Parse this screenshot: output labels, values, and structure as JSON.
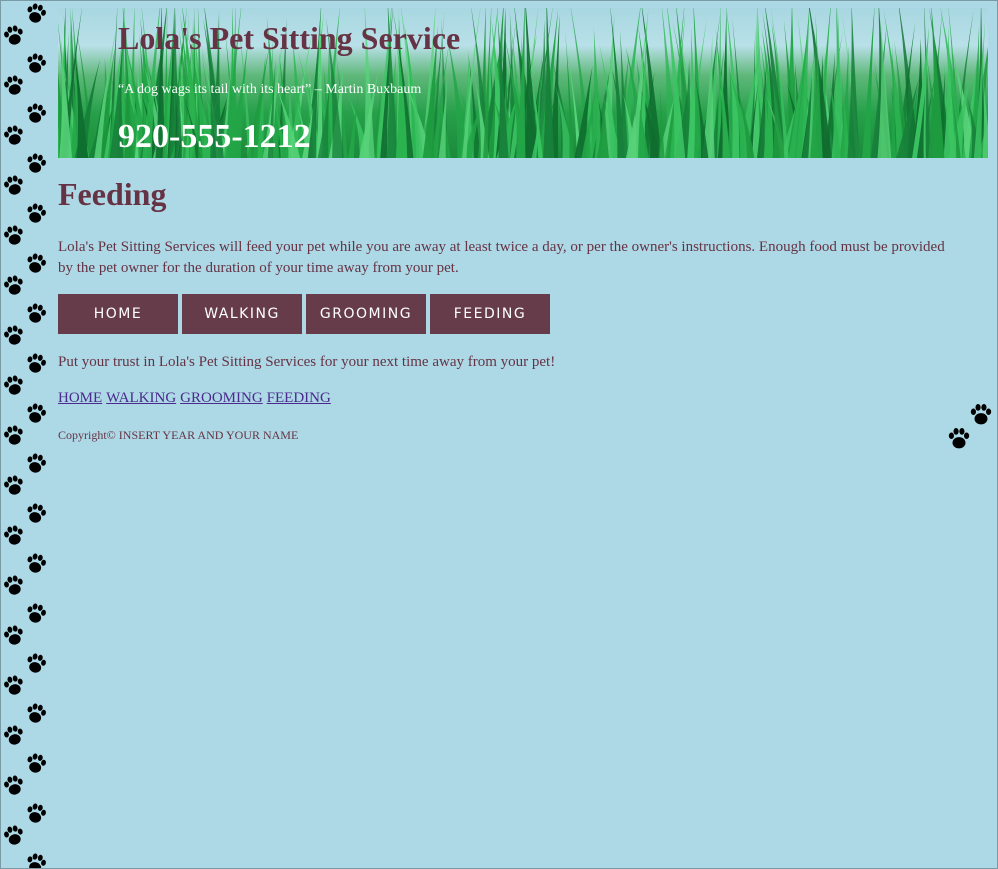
{
  "header": {
    "title": "Lola's Pet Sitting Service",
    "quote": "“A dog wags its tail with its heart” – Martin Buxbaum",
    "phone": "920-555-1212"
  },
  "main": {
    "heading": "Feeding",
    "intro": "Lola's Pet Sitting Services will feed your pet while you are away at least twice a day, or per the owner's instructions. Enough food must be provided by the pet owner for the duration of your time away from your pet.",
    "trust": "Put your trust in Lola's Pet Sitting Services for your next time away from your pet!"
  },
  "nav_buttons": [
    "HOME",
    "WALKING",
    "GROOMING",
    "FEEDING"
  ],
  "text_nav": [
    "HOME",
    "WALKING",
    "GROOMING",
    "FEEDING"
  ],
  "footer": {
    "copyright": "Copyright© INSERT YEAR AND YOUR NAME"
  },
  "icons": {
    "paw": "paw-print-icon"
  },
  "colors": {
    "background": "#add8e6",
    "accent": "#663344",
    "button": "#663c4b",
    "link": "#4a2a8c"
  }
}
